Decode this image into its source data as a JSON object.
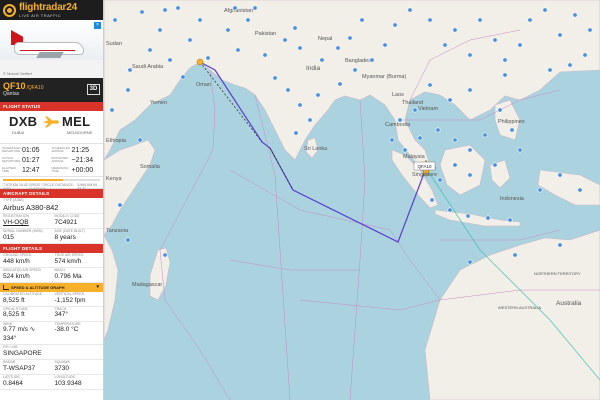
{
  "map": {
    "labels": {
      "afghanistan": "Afghanistan",
      "pakistan": "Pakistan",
      "india": "India",
      "nepal": "Nepal",
      "bangladesh": "Bangladesh",
      "myanmar": "Myanmar (Burma)",
      "laos": "Laos",
      "thailand": "Thailand",
      "vietnam": "Vietnam",
      "cambodia": "Cambodia",
      "philippines": "Philippines",
      "saudi": "Saudi Arabia",
      "oman": "Oman",
      "yemen": "Yemen",
      "ethiopia": "Ethiopia",
      "somalia": "Somalia",
      "kenya": "Kenya",
      "tanzania": "Tanzania",
      "madagascar": "Madagascar",
      "srilanka": "Sri Lanka",
      "malaysia": "Malaysia",
      "singapore": "Singapore",
      "indonesia": "Indonesia",
      "northern_territory": "NORTHERN TERRITORY",
      "western_australia": "WESTERN AUSTRALIA",
      "australia": "Australia",
      "sudan": "Sudan",
      "dubai_label": "DXB",
      "flight_tag": "QFA10"
    }
  },
  "sidebar": {
    "logo": {
      "name": "flightradar24",
      "tagline": "LIVE AIR TRAFFIC",
      "icon": "radar-icon"
    },
    "ad": {
      "caption": "© Marcel Seifert"
    },
    "flight": {
      "callsign": "QF10",
      "icao": "/QFA10",
      "airline": "Qantas",
      "view3d_label": "3D"
    },
    "status_header": "FLIGHT STATUS",
    "route": {
      "from_code": "DXB",
      "from_city": "DUBAI",
      "to_code": "MEL",
      "to_city": "MELBOURNE"
    },
    "times": [
      {
        "label_a": "SCHEDULED DEPARTURE",
        "value_a": "01:05",
        "label_b": "SCHEDULED ARRIVAL",
        "value_b": "21:25"
      },
      {
        "label_a": "ACTUAL DEPARTURE",
        "value_a": "01:27",
        "label_b": "ESTIMATED ARRIVAL",
        "value_b": "~21:34"
      },
      {
        "label_a": "ELAPSED TIME",
        "value_a": "12:47",
        "label_b": "REMAINING TIME",
        "value_b": "+00:00"
      }
    ],
    "progress": {
      "fraction": 0.62,
      "distance_label": "GREAT CIRCLE DISTANCE: 11,645 KM",
      "left_km": "7,075 KM",
      "left_ago": "10:42 AGO",
      "right_km": "3,964 KM",
      "right_in": "IN 53:31"
    },
    "aircraft_header": "AIRCRAFT DETAILS",
    "aircraft": {
      "type_label": "TYPE (A388)",
      "type_value": "Airbus A380-842",
      "reg_label": "REGISTRATION",
      "reg_value": "VH-OQB",
      "mode_s_label": "MODE-S CODE",
      "mode_s_value": "7C4921",
      "serial_label": "SERIAL NUMBER (MSN)",
      "serial_value": "015",
      "age_label": "AGE (DATE BUILT)",
      "age_value": "8 years"
    },
    "flight_header": "FLIGHT DETAILS",
    "speeds": {
      "gs_label": "GROUND SPEED",
      "gs_value": "448 km/h",
      "tas_label": "TRUE AIR SPEED",
      "tas_value": "574 km/h",
      "ias_label": "INDICATED AIR SPEED",
      "ias_value": "524 km/h",
      "mach_label": "MACH",
      "mach_value": "0.796 Ma"
    },
    "graph_label": "SPEED & ALTITUDE GRAPH",
    "alt": {
      "cal_label": "CALIBRATED ALTITUDE",
      "cal_value": "8,525 ft",
      "vs_label": "VERTICAL SPEED",
      "vs_value": "-1,152 fpm",
      "gps_label": "GPS ALTITUDE",
      "gps_value": "8,525 ft",
      "track_label": "TRACK",
      "track_value": "347°"
    },
    "wind": {
      "wind_label": "WIND",
      "wind_value": "9.77 m/s ∿ 334°",
      "temp_label": "TEMPERATURE",
      "temp_value": "-38.0 °C"
    },
    "radar": {
      "fir_label": "FIR / UIR",
      "fir_value": "SINGAPORE",
      "radar_label": "RADAR",
      "radar_value": "T-WSAP37",
      "squawk_label": "SQUAWK",
      "squawk_value": "3730",
      "lat_label": "LATITUDE",
      "lat_value": "0.8464",
      "lon_label": "LONGITUDE",
      "lon_value": "103.9348"
    }
  }
}
